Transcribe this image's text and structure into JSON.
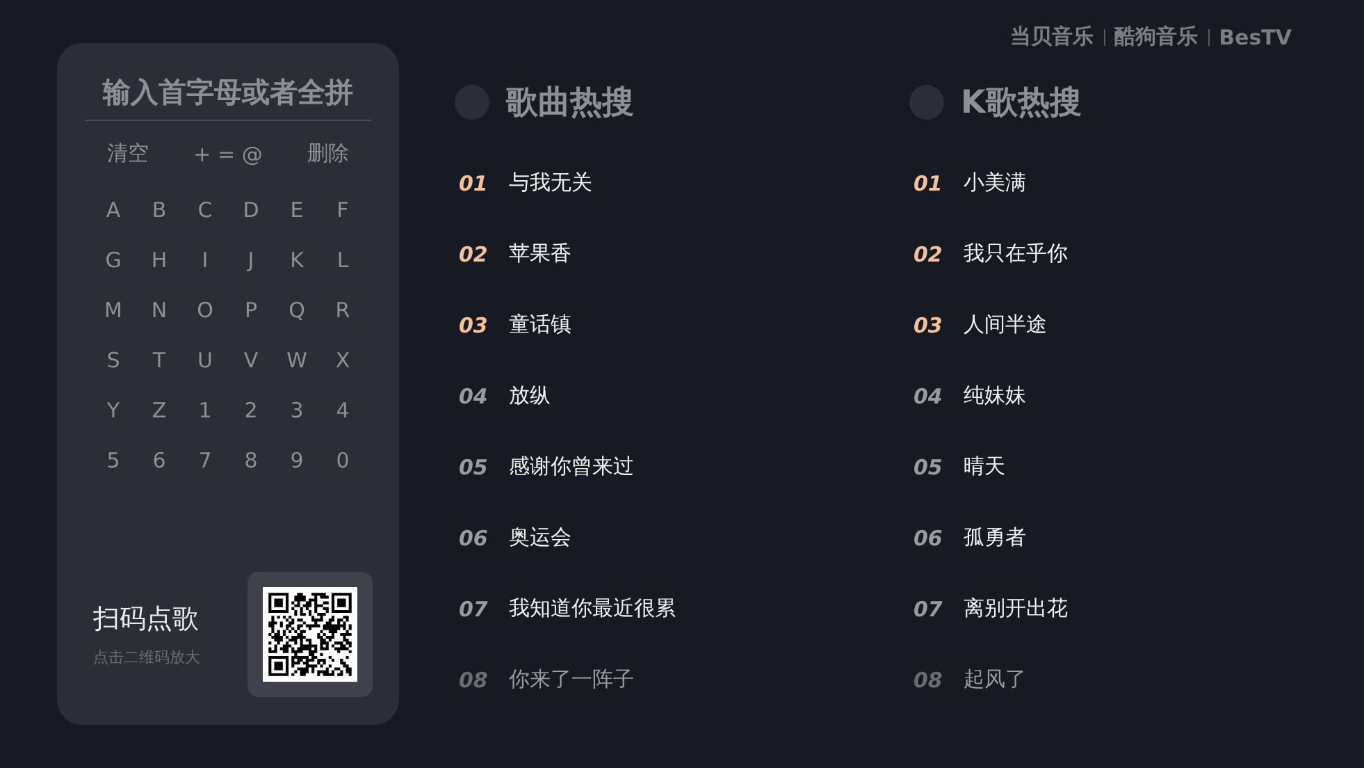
{
  "brand_logos": [
    "当贝音乐",
    "酷狗音乐",
    "BesTV"
  ],
  "keyboard": {
    "title": "输入首字母或者全拼",
    "function_keys": [
      "清空",
      "+ = @",
      "删除"
    ],
    "keys": [
      "A",
      "B",
      "C",
      "D",
      "E",
      "F",
      "G",
      "H",
      "I",
      "J",
      "K",
      "L",
      "M",
      "N",
      "O",
      "P",
      "Q",
      "R",
      "S",
      "T",
      "U",
      "V",
      "W",
      "X",
      "Y",
      "Z",
      "1",
      "2",
      "3",
      "4",
      "5",
      "6",
      "7",
      "8",
      "9",
      "0"
    ],
    "scan": {
      "title": "扫码点歌",
      "hint": "点击二维码放大"
    }
  },
  "lists": [
    {
      "title": "歌曲热搜",
      "items": [
        {
          "rank": "01",
          "title": "与我无关",
          "kind": "top"
        },
        {
          "rank": "02",
          "title": "苹果香",
          "kind": "top"
        },
        {
          "rank": "03",
          "title": "童话镇",
          "kind": "top"
        },
        {
          "rank": "04",
          "title": "放纵",
          "kind": "normal"
        },
        {
          "rank": "05",
          "title": "感谢你曾来过",
          "kind": "normal"
        },
        {
          "rank": "06",
          "title": "奥运会",
          "kind": "normal"
        },
        {
          "rank": "07",
          "title": "我知道你最近很累",
          "kind": "normal"
        },
        {
          "rank": "08",
          "title": "你来了一阵子",
          "kind": "faded"
        }
      ]
    },
    {
      "title": "K歌热搜",
      "items": [
        {
          "rank": "01",
          "title": "小美满",
          "kind": "top"
        },
        {
          "rank": "02",
          "title": "我只在乎你",
          "kind": "top"
        },
        {
          "rank": "03",
          "title": "人间半途",
          "kind": "top"
        },
        {
          "rank": "04",
          "title": "纯妹妹",
          "kind": "normal"
        },
        {
          "rank": "05",
          "title": "晴天",
          "kind": "normal"
        },
        {
          "rank": "06",
          "title": "孤勇者",
          "kind": "normal"
        },
        {
          "rank": "07",
          "title": "离别开出花",
          "kind": "normal"
        },
        {
          "rank": "08",
          "title": "起风了",
          "kind": "faded"
        }
      ]
    }
  ]
}
